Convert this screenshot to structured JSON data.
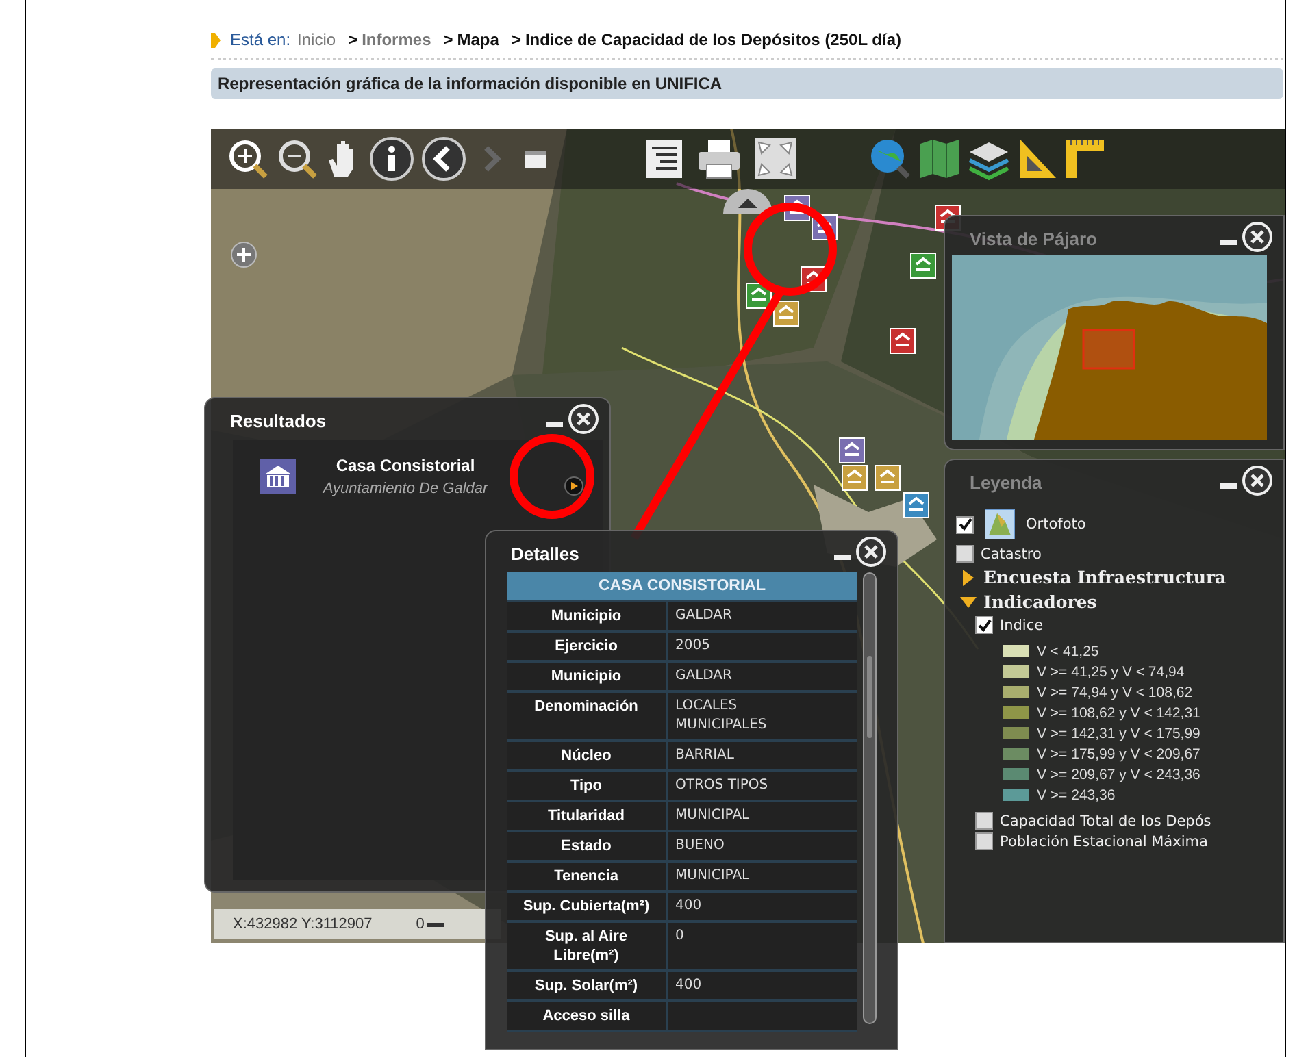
{
  "breadcrumb": {
    "prefix": "Está en:",
    "items": [
      {
        "label": "Inicio",
        "kind": "home"
      },
      {
        "label": "Informes",
        "kind": "link",
        "separator": ">"
      },
      {
        "label": "Mapa",
        "kind": "page",
        "separator": ">"
      },
      {
        "label": "Indice de Capacidad de los Depósitos (250L día)",
        "kind": "page",
        "separator": ">"
      }
    ]
  },
  "banner": "Representación gráfica de la información disponible en UNIFICA",
  "map": {
    "results": {
      "title": "Resultados",
      "items": [
        {
          "title": "Casa Consistorial",
          "subtitle": "Ayuntamiento De Galdar"
        }
      ]
    },
    "details": {
      "title": "Detalles",
      "header": "CASA CONSISTORIAL",
      "rows": [
        {
          "label": "Municipio",
          "value": "GALDAR"
        },
        {
          "label": "Ejercicio",
          "value": "2005"
        },
        {
          "label": "Municipio",
          "value": "GALDAR"
        },
        {
          "label": "Denominación",
          "value": "LOCALES MUNICIPALES"
        },
        {
          "label": "Núcleo",
          "value": "BARRIAL"
        },
        {
          "label": "Tipo",
          "value": "OTROS TIPOS"
        },
        {
          "label": "Titularidad",
          "value": "MUNICIPAL"
        },
        {
          "label": "Estado",
          "value": "BUENO"
        },
        {
          "label": "Tenencia",
          "value": "MUNICIPAL"
        },
        {
          "label": "Sup. Cubierta(m²)",
          "value": "400"
        },
        {
          "label": "Sup. al Aire Libre(m²)",
          "value": "0"
        },
        {
          "label": "Sup. Solar(m²)",
          "value": "400"
        },
        {
          "label": "Acceso silla"
        }
      ]
    },
    "overview": {
      "title": "Vista de Pájaro"
    },
    "legend": {
      "title": "Leyenda",
      "layers": [
        {
          "label": "Ortofoto",
          "checked": true
        },
        {
          "label": "Catastro",
          "checked": false
        }
      ],
      "groups": [
        {
          "label": "Encuesta Infraestructura",
          "expanded": false
        },
        {
          "label": "Indicadores",
          "expanded": true,
          "children": [
            {
              "label": "Indice",
              "checked": true,
              "classes": [
                {
                  "label": "V < 41,25",
                  "color": "#d9dfb4"
                },
                {
                  "label": "V >= 41,25 y V < 74,94",
                  "color": "#c3c995"
                },
                {
                  "label": "V >= 74,94 y V < 108,62",
                  "color": "#a9ae6e"
                },
                {
                  "label": "V >= 108,62 y V < 142,31",
                  "color": "#8f9648"
                },
                {
                  "label": "V >= 142,31 y V < 175,99",
                  "color": "#7f8c50"
                },
                {
                  "label": "V >= 175,99 y V < 209,67",
                  "color": "#6c8c62"
                },
                {
                  "label": "V >= 209,67 y V < 243,36",
                  "color": "#5b8a72"
                },
                {
                  "label": "V >= 243,36",
                  "color": "#5c9a98"
                }
              ]
            },
            {
              "label": "Capacidad Total de los Depós",
              "checked": false
            },
            {
              "label": "Población Estacional Máxima",
              "checked": false
            }
          ]
        }
      ]
    },
    "coordinates": "X:432982 Y:3112907",
    "scale": "0"
  }
}
